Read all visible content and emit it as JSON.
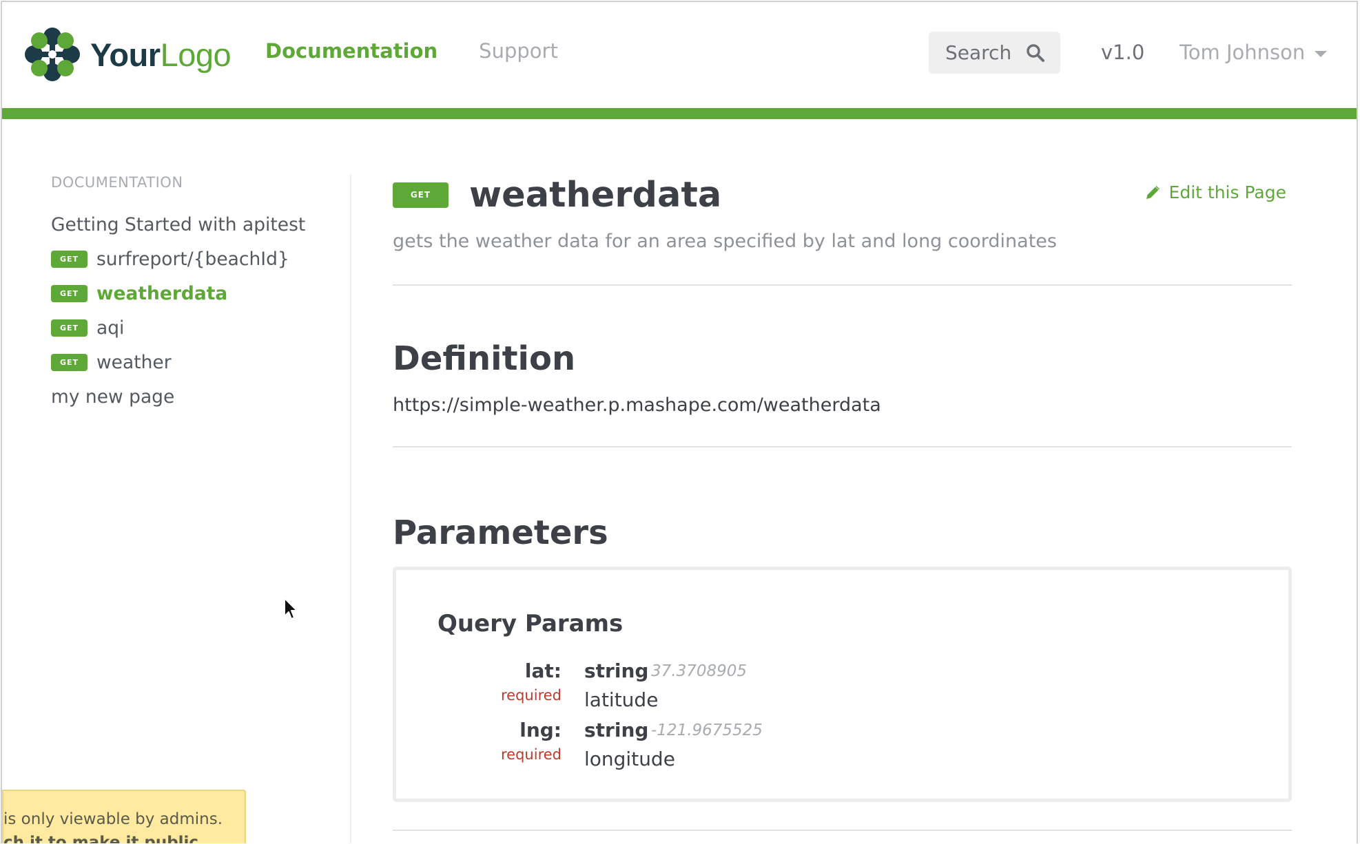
{
  "header": {
    "logo": {
      "part1": "Your",
      "part2": "Logo"
    },
    "nav": [
      {
        "label": "Documentation",
        "active": true
      },
      {
        "label": "Support",
        "active": false
      }
    ],
    "search": {
      "label": "Search",
      "icon": "search-icon"
    },
    "version": "v1.0",
    "user": "Tom Johnson"
  },
  "sidebar": {
    "heading": "DOCUMENTATION",
    "items": [
      {
        "label": "Getting Started with apitest",
        "badge": ""
      },
      {
        "label": "surfreport/{beachId}",
        "badge": "GET"
      },
      {
        "label": "weatherdata",
        "badge": "GET",
        "active": true
      },
      {
        "label": "aqi",
        "badge": "GET"
      },
      {
        "label": "weather",
        "badge": "GET"
      },
      {
        "label": "my new page",
        "badge": ""
      }
    ]
  },
  "main": {
    "badge": "GET",
    "title": "weatherdata",
    "edit_label": "Edit this Page",
    "subtitle": "gets the weather data for an area specified by lat and long coordinates",
    "definition": {
      "heading": "Definition",
      "url": "https://simple-weather.p.mashape.com/weatherdata"
    },
    "parameters": {
      "heading": "Parameters",
      "query_heading": "Query Params",
      "items": [
        {
          "name": "lat:",
          "required": "required",
          "type": "string",
          "example": "37.3708905",
          "description": "latitude"
        },
        {
          "name": "lng:",
          "required": "required",
          "type": "string",
          "example": "-121.9675525",
          "description": "longitude"
        }
      ]
    }
  },
  "notice": {
    "line1": "is only viewable by admins.",
    "line2": "ch it to make it public"
  },
  "colors": {
    "accent": "#5ea838",
    "brand_dark": "#1d3a47",
    "required": "#c0392b",
    "notice_bg": "#ffeaa0"
  }
}
